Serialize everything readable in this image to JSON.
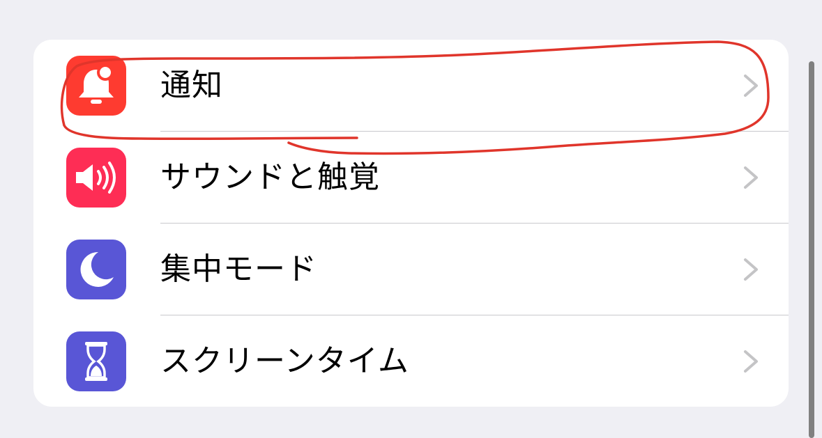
{
  "settings": {
    "items": [
      {
        "label": "通知",
        "icon": "bell-badge-icon",
        "color": "#fe3b30"
      },
      {
        "label": "サウンドと触覚",
        "icon": "speaker-icon",
        "color": "#fe2d55"
      },
      {
        "label": "集中モード",
        "icon": "moon-icon",
        "color": "#5956d6"
      },
      {
        "label": "スクリーンタイム",
        "icon": "hourglass-icon",
        "color": "#5956d6"
      }
    ]
  },
  "annotation": {
    "color": "#e0352b"
  }
}
